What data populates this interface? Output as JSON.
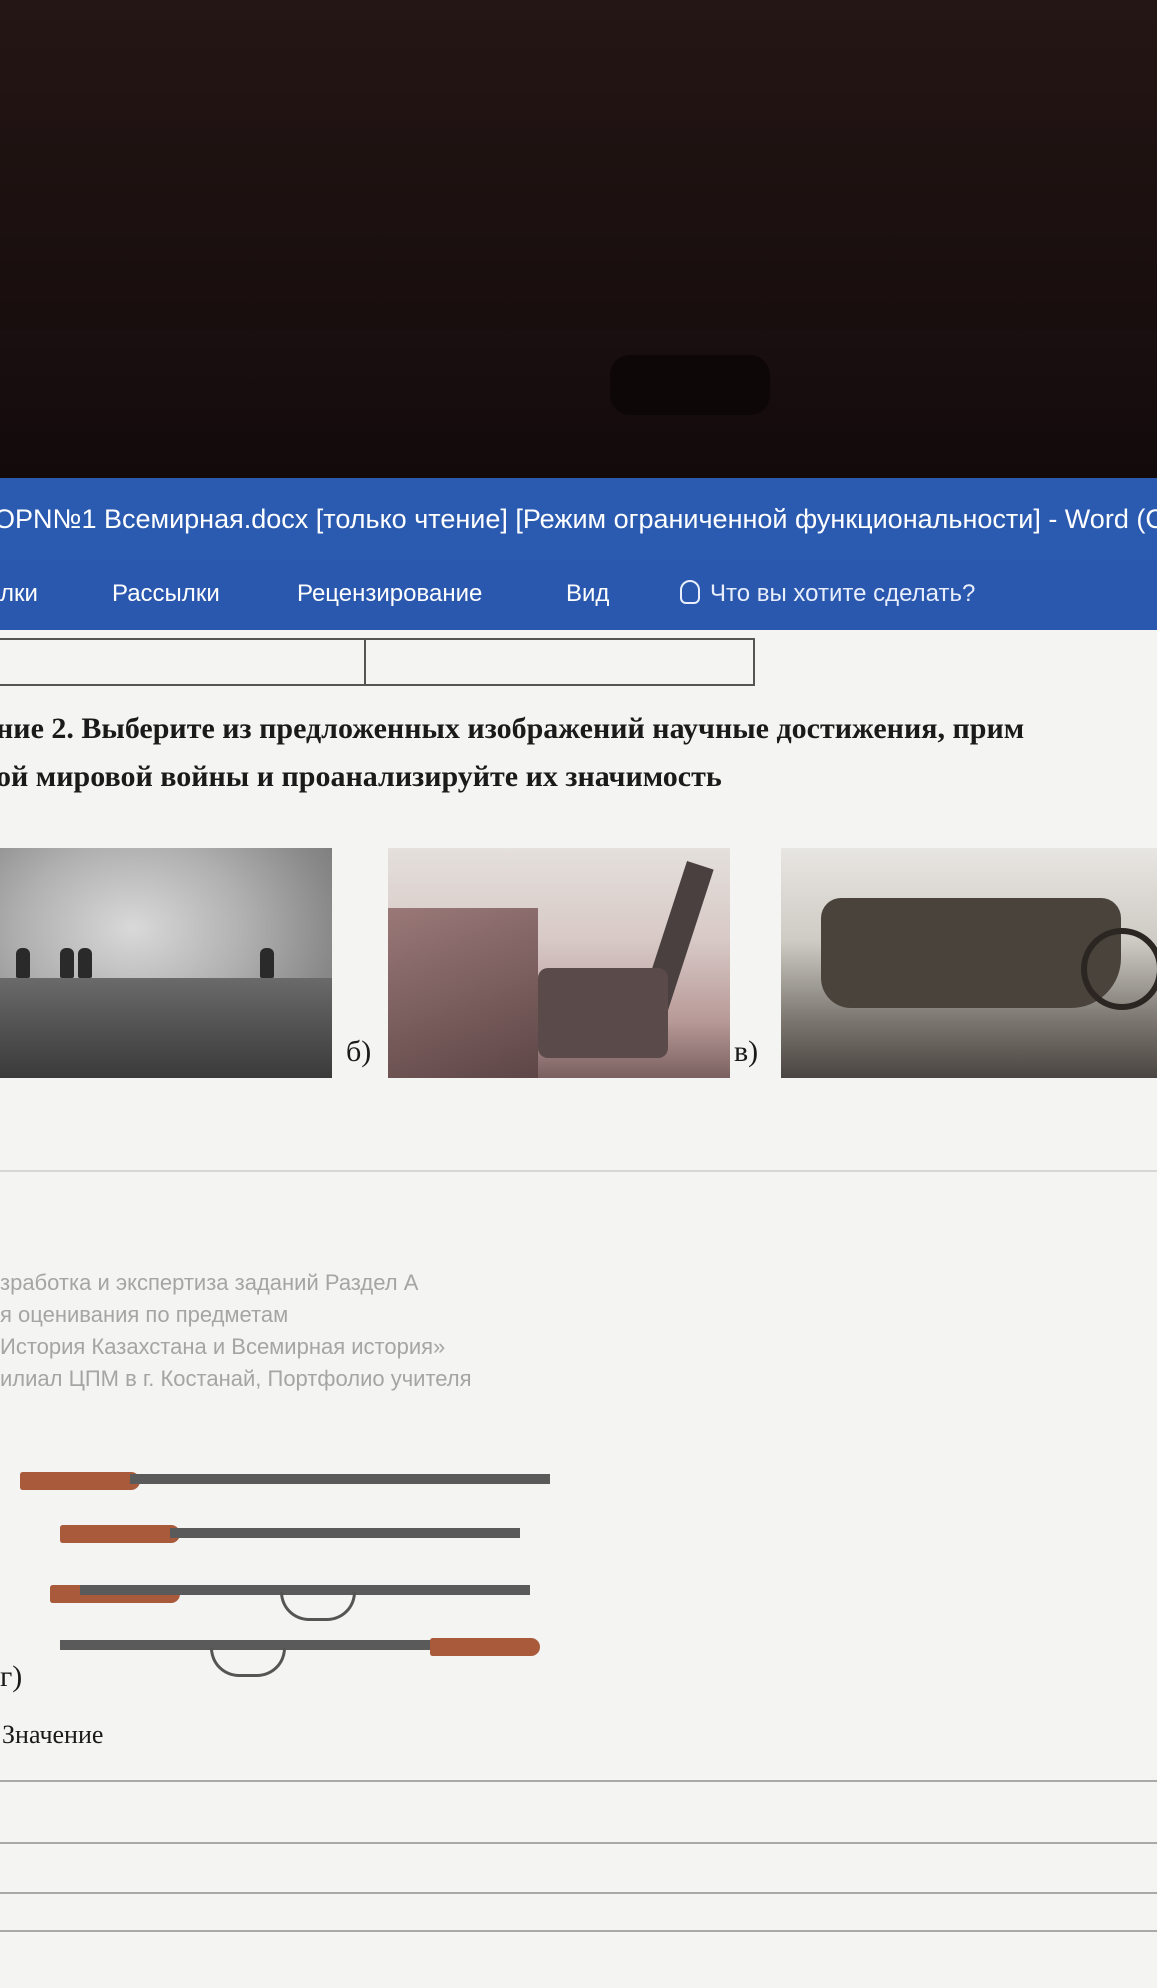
{
  "window": {
    "title": "ОРN№1 Всемирная.docx [только чтение] [Режим ограниченной функциональности] - Word (С"
  },
  "ribbon": {
    "tabs": [
      "лки",
      "Рассылки",
      "Рецензирование",
      "Вид"
    ],
    "tell_me": "Что вы хотите сделать?"
  },
  "document": {
    "task_line1": "ние 2.  Выберите из предложенных изображений научные достижения, прим",
    "task_line2": "ой мировой войны и проанализируйте их значимость",
    "image_labels": [
      "б)",
      "в)",
      "г)"
    ],
    "faded_lines": [
      "зработка и экспертиза заданий Раздел А",
      "я оценивания по предметам",
      "История Казахстана и Всемирная история»",
      "илиал ЦПМ в г. Костанай, Портфолио учителя"
    ],
    "meaning_label": "Значение"
  }
}
